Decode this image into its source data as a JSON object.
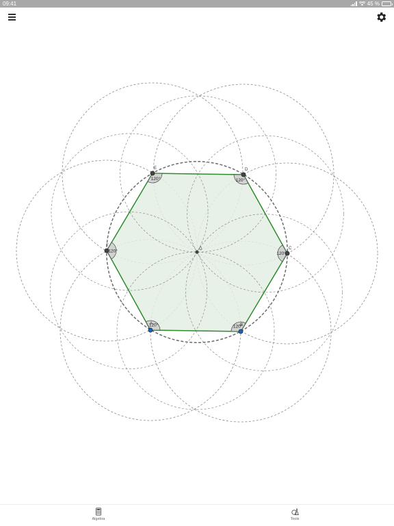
{
  "status_bar": {
    "time": "09:41",
    "battery": "45 %",
    "battery_level": 0.45,
    "icons": [
      "cellular-signal-icon",
      "wifi-icon",
      "battery-icon"
    ]
  },
  "toolbar": {
    "menu_icon": "hamburger-menu-icon",
    "settings_icon": "gear-icon"
  },
  "construction": {
    "hexagon_color": "#2e8b2e",
    "hexagon_fill": "#e4efe4",
    "point_colors": {
      "free": "#1565c0",
      "dependent": "#444444"
    },
    "center_label": "G",
    "points": [
      {
        "label": "A",
        "color": "#1565c0"
      },
      {
        "label": "B",
        "color": "#1565c0"
      },
      {
        "label": "C",
        "color": "#444444"
      },
      {
        "label": "D",
        "color": "#444444"
      },
      {
        "label": "E",
        "color": "#444444"
      },
      {
        "label": "F",
        "color": "#444444"
      }
    ],
    "angles": [
      {
        "vertex": "A",
        "label": "120°"
      },
      {
        "vertex": "B",
        "label": "120°"
      },
      {
        "vertex": "C",
        "label": "120°"
      },
      {
        "vertex": "D",
        "label": "120°"
      },
      {
        "vertex": "E",
        "label": "120°"
      },
      {
        "vertex": "F",
        "label": "120°"
      }
    ]
  },
  "bottom_nav": {
    "tabs": [
      {
        "label": "Algebra",
        "icon": "calculator-icon"
      },
      {
        "label": "Tools",
        "icon": "tools-icon"
      }
    ]
  }
}
